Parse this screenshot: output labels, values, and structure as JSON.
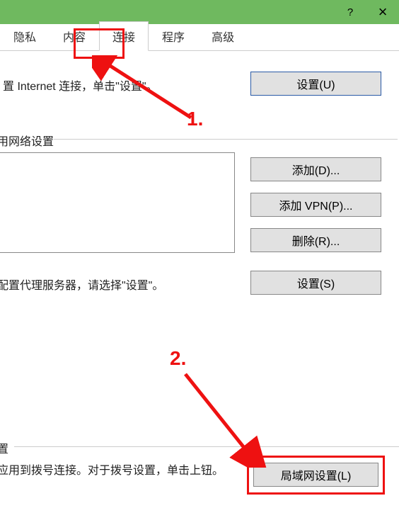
{
  "titlebar": {
    "help": "?",
    "close": "×"
  },
  "tabs": {
    "privacy": "隐私",
    "content": "内容",
    "connections": "连接",
    "programs": "程序",
    "advanced": "高级"
  },
  "main": {
    "desc_connection": "置 Internet 连接，单击\"设置\"。",
    "setup_u": "设置(U)",
    "dialup_section": "用网络设置",
    "add_d": "添加(D)...",
    "add_vpn": "添加 VPN(P)...",
    "delete_r": "删除(R)...",
    "set_s": "设置(S)",
    "desc_proxy": "配置代理服务器，请选择\"设置\"。",
    "lan_section": "置",
    "desc_lan": "应用到拨号连接。对于拨号设置，单击上钮。",
    "lan_l": "局域网设置(L)"
  },
  "annotations": {
    "num1": "1.",
    "num2": "2."
  }
}
